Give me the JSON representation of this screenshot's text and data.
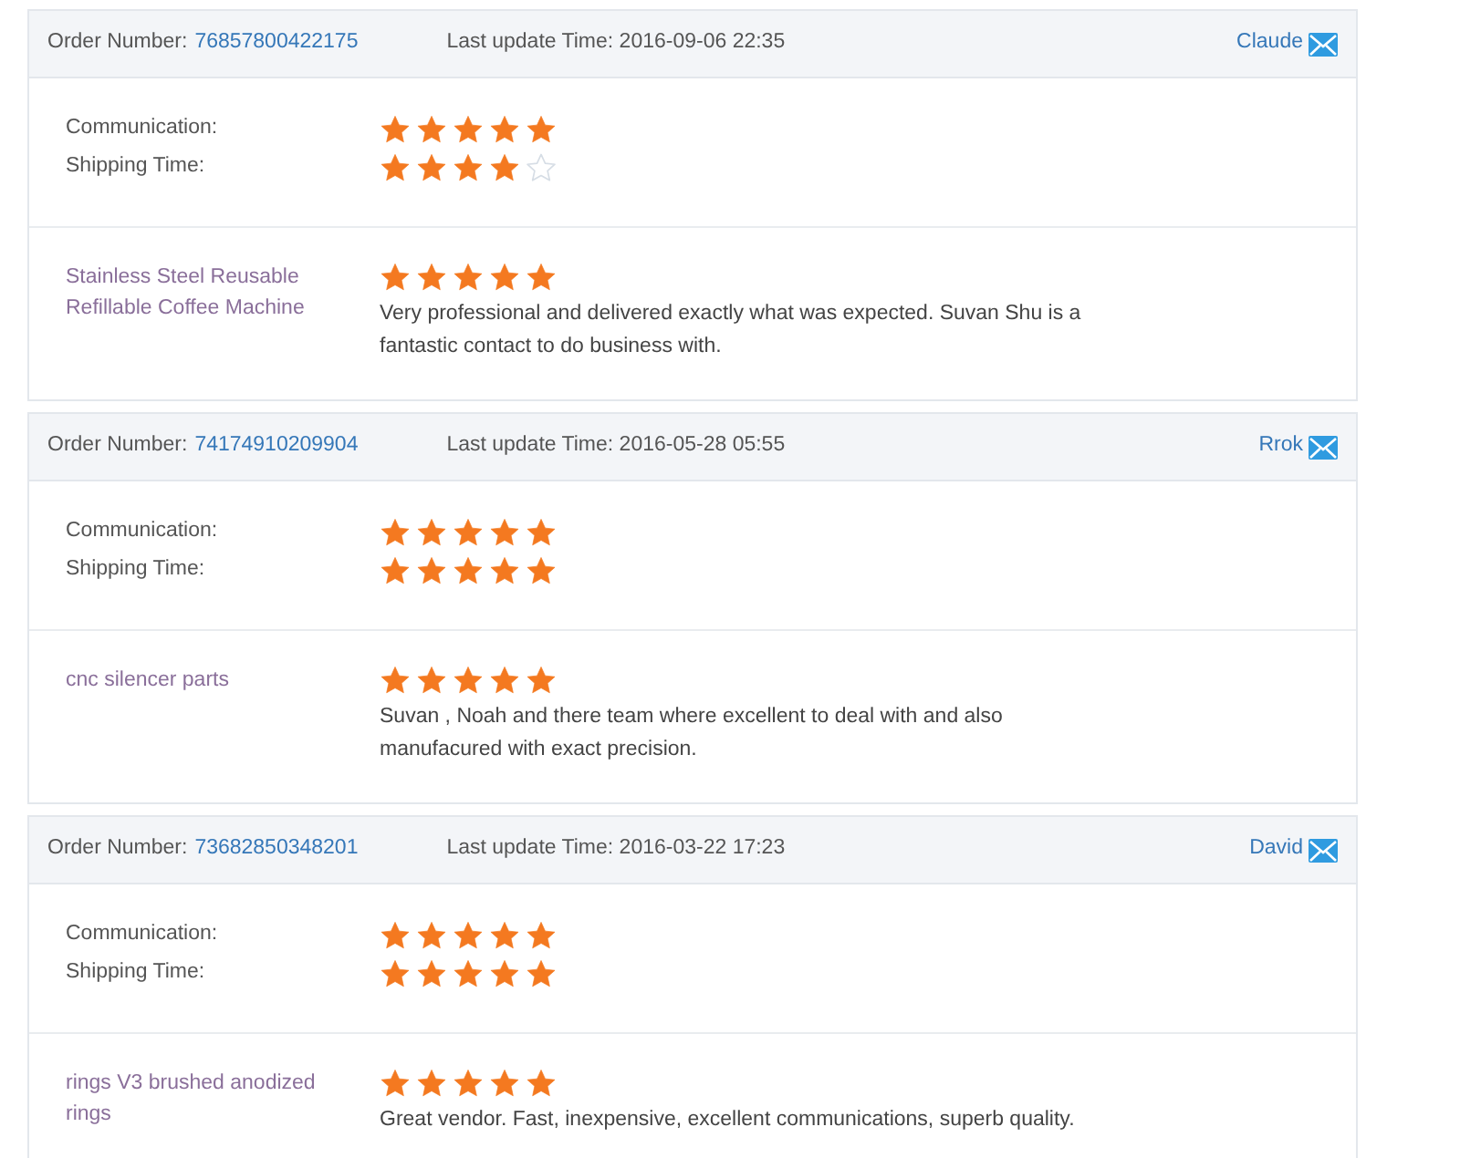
{
  "orders": [
    {
      "order_label": "Order Number:",
      "order_number": "76857800422175",
      "update_label": "Last update Time: 2016-09-06 22:35",
      "buyer": "Claude",
      "ratings": [
        {
          "label": "Communication:",
          "stars": 5
        },
        {
          "label": "Shipping Time:",
          "stars": 4
        }
      ],
      "product": {
        "name": "Stainless Steel Reusable Refillable Coffee Machine",
        "stars": 5,
        "comment": "Very professional and delivered exactly what was expected. Suvan Shu is a fantastic contact to do business with."
      }
    },
    {
      "order_label": "Order Number:",
      "order_number": "74174910209904",
      "update_label": "Last update Time: 2016-05-28 05:55",
      "buyer": "Rrok",
      "ratings": [
        {
          "label": "Communication:",
          "stars": 5
        },
        {
          "label": "Shipping Time:",
          "stars": 5
        }
      ],
      "product": {
        "name": "cnc silencer parts",
        "stars": 5,
        "comment": "Suvan , Noah and there team where excellent to deal with and also manufacured with exact precision."
      }
    },
    {
      "order_label": "Order Number:",
      "order_number": "73682850348201",
      "update_label": "Last update Time: 2016-03-22 17:23",
      "buyer": "David",
      "ratings": [
        {
          "label": "Communication:",
          "stars": 5
        },
        {
          "label": "Shipping Time:",
          "stars": 5
        }
      ],
      "product": {
        "name": "rings V3 brushed anodized rings",
        "stars": 5,
        "comment": "Great vendor. Fast, inexpensive, excellent communications, superb quality."
      }
    }
  ]
}
